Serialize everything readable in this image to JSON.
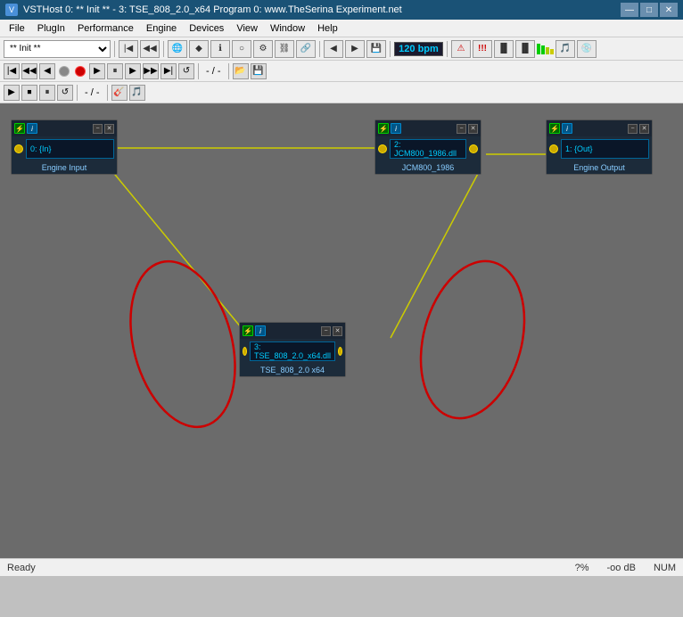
{
  "titlebar": {
    "title": "VSTHost 0: ** Init ** - 3: TSE_808_2.0_x64 Program 0: www.TheSerina Experiment.net",
    "icon": "V",
    "minimize": "—",
    "maximize": "□",
    "close": "✕"
  },
  "menubar": {
    "items": [
      "File",
      "PlugIn",
      "Performance",
      "Engine",
      "Devices",
      "View",
      "Window",
      "Help"
    ]
  },
  "toolbar1": {
    "preset_name": "** Init **",
    "bpm": "120 bpm"
  },
  "toolbar2": {
    "position": "- / -"
  },
  "toolbar3": {
    "position": "- / -"
  },
  "nodes": {
    "engine_input": {
      "id": "0: {In}",
      "label": "Engine Input"
    },
    "jcm800": {
      "id": "2: JCM800_1986.dll",
      "label": "JCM800_1986"
    },
    "engine_output": {
      "id": "1: {Out}",
      "label": "Engine Output"
    },
    "tse808": {
      "id": "3: TSE_808_2.0_x64.dll",
      "label": "TSE_808_2.0 x64"
    }
  },
  "statusbar": {
    "ready": "Ready",
    "zoom": "?%",
    "db": "-oo dB",
    "numlock": "NUM"
  }
}
